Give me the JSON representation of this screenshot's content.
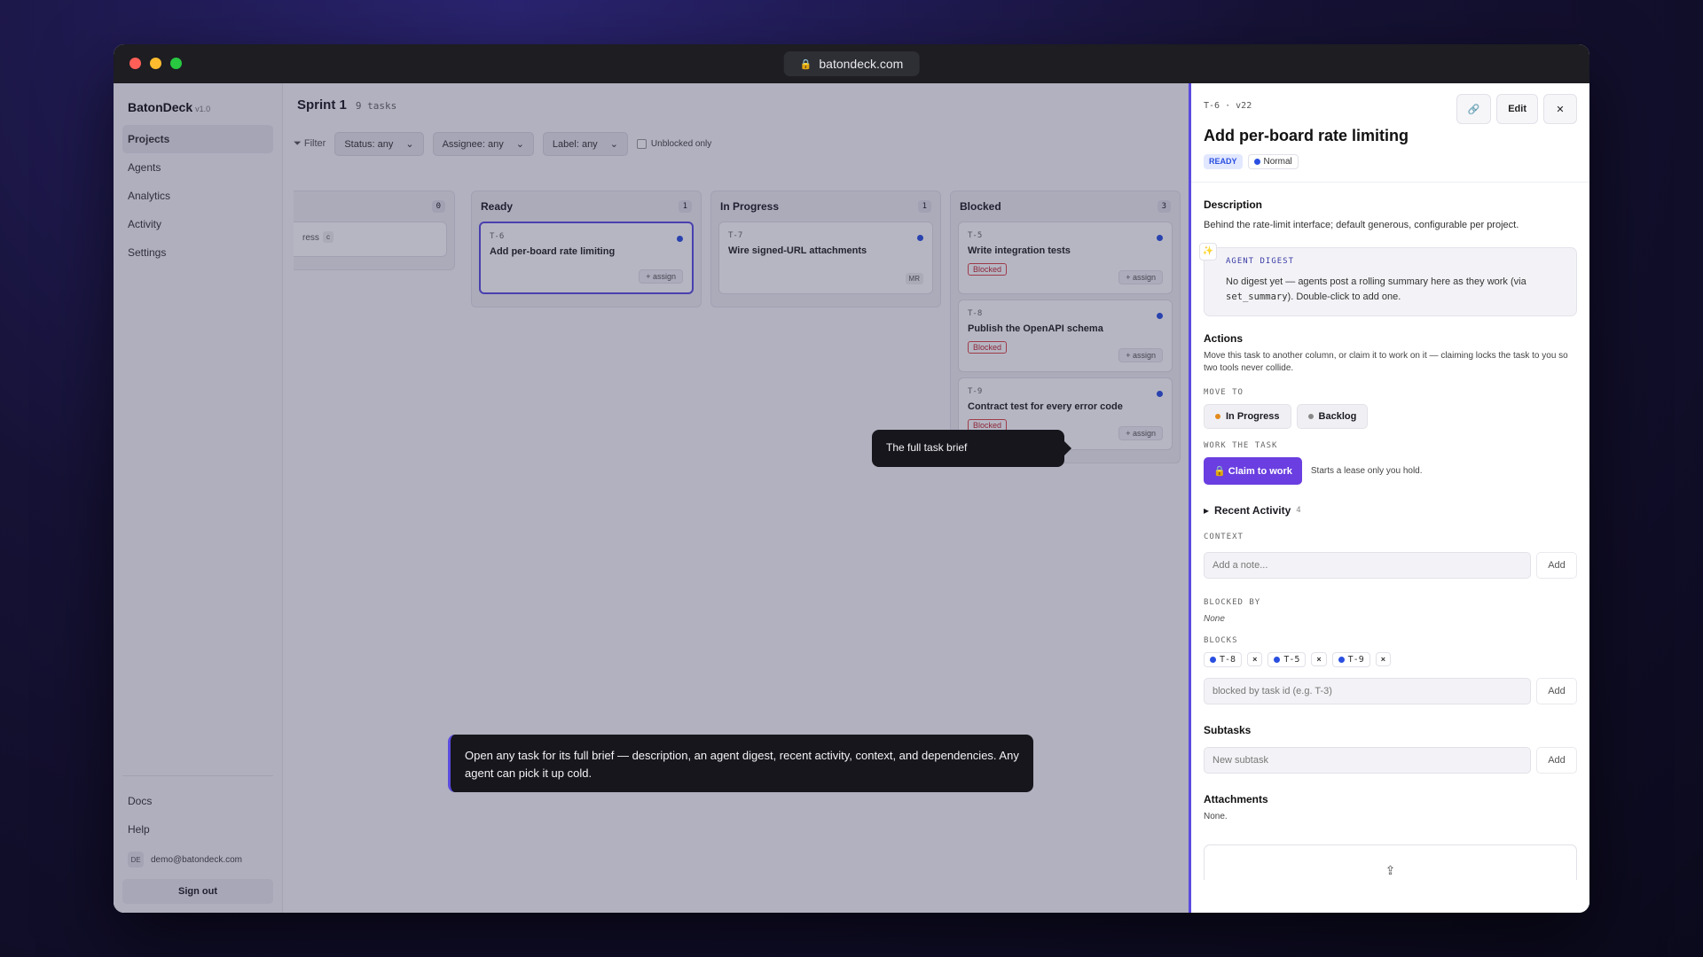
{
  "browser": {
    "url": "batondeck.com"
  },
  "sidebar": {
    "brand": "BatonDeck",
    "version": "v1.0",
    "items": [
      {
        "label": "Projects",
        "active": true
      },
      {
        "label": "Agents"
      },
      {
        "label": "Analytics"
      },
      {
        "label": "Activity"
      },
      {
        "label": "Settings"
      }
    ],
    "docs": "Docs",
    "help": "Help",
    "user_initials": "DE",
    "user_email": "demo@batondeck.com",
    "sign_out": "Sign out"
  },
  "board": {
    "sprint": "Sprint 1",
    "task_count": "9 tasks",
    "filter_label": "Filter",
    "status": "Status: any",
    "assignee": "Assignee: any",
    "label": "Label: any",
    "unblocked": "Unblocked only",
    "columns": [
      {
        "name": "",
        "count": "0",
        "partial_text": "ress",
        "partial_badge": "c"
      },
      {
        "name": "Ready",
        "count": "1",
        "cards": [
          {
            "id": "T-6",
            "title": "Add per-board rate limiting",
            "assign": "+ assign"
          }
        ]
      },
      {
        "name": "In Progress",
        "count": "1",
        "cards": [
          {
            "id": "T-7",
            "title": "Wire signed-URL attachments",
            "initials": "MR"
          }
        ]
      },
      {
        "name": "Blocked",
        "count": "3",
        "cards": [
          {
            "id": "T-5",
            "title": "Write integration tests",
            "tag": "Blocked",
            "assign": "+ assign"
          },
          {
            "id": "T-8",
            "title": "Publish the OpenAPI schema",
            "tag": "Blocked",
            "assign": "+ assign"
          },
          {
            "id": "T-9",
            "title": "Contract test for every error code",
            "tag": "Blocked",
            "assign": "+ assign"
          }
        ]
      }
    ]
  },
  "tooltips": {
    "small": "The full task brief",
    "big": "Open any task for its full brief — description, an agent digest, recent activity, context, and dependencies. Any agent can pick it up cold."
  },
  "panel": {
    "id": "T-6",
    "sep": "·",
    "version": "v22",
    "edit": "Edit",
    "title": "Add per-board rate limiting",
    "status": "READY",
    "priority": "Normal",
    "description_h": "Description",
    "description": "Behind the rate-limit interface; default generous, configurable per project.",
    "digest_label": "AGENT DIGEST",
    "digest_text_1": "No digest yet — agents post a rolling summary here as they work (via ",
    "digest_code": "set_summary",
    "digest_text_2": "). Double-click to add one.",
    "actions_h": "Actions",
    "actions_text": "Move this task to another column, or claim it to work on it — claiming locks the task to you so two tools never collide.",
    "move_to": "MOVE TO",
    "move_in_progress": "In Progress",
    "move_backlog": "Backlog",
    "work_label": "WORK THE TASK",
    "claim": "Claim to work",
    "claim_hint": "Starts a lease only you hold.",
    "recent_h": "Recent Activity",
    "recent_count": "4",
    "context_label": "CONTEXT",
    "note_placeholder": "Add a note...",
    "add": "Add",
    "blocked_by_label": "BLOCKED BY",
    "blocked_by_none": "None",
    "blocks_label": "BLOCKS",
    "blocks": [
      "T-8",
      "T-5",
      "T-9"
    ],
    "x": "×",
    "blocked_placeholder": "blocked by task id (e.g. T-3)",
    "subtasks_h": "Subtasks",
    "subtask_placeholder": "New subtask",
    "attachments_h": "Attachments",
    "attachments_none": "None."
  }
}
